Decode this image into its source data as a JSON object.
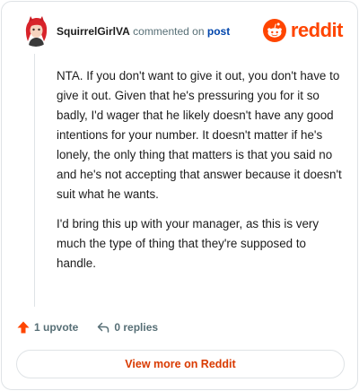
{
  "header": {
    "username": "SquirrelGirlVA",
    "verb": "commented on",
    "post_link": "post",
    "brand_word": "reddit"
  },
  "comment": {
    "paragraphs": [
      "NTA. If you don't want to give it out, you don't have to give it out. Given that he's pressuring you for it so badly, I'd wager that he likely doesn't have any good intentions for your number. It doesn't matter if he's lonely, the only thing that matters is that you said no and he's not accepting that answer because it doesn't suit what he wants.",
      "I'd bring this up with your manager, as this is very much the type of thing that they're supposed to handle."
    ]
  },
  "actions": {
    "upvote_label": "1 upvote",
    "replies_label": "0 replies"
  },
  "footer": {
    "view_more_label": "View more on Reddit"
  },
  "colors": {
    "brand": "#ff4500",
    "link": "#0045ac",
    "cta": "#d93a00",
    "muted": "#576f76"
  },
  "icons": {
    "avatar": "avatar-illustration",
    "brand": "reddit-snoo-icon",
    "upvote": "upvote-arrow-icon",
    "reply": "reply-arrow-icon"
  }
}
